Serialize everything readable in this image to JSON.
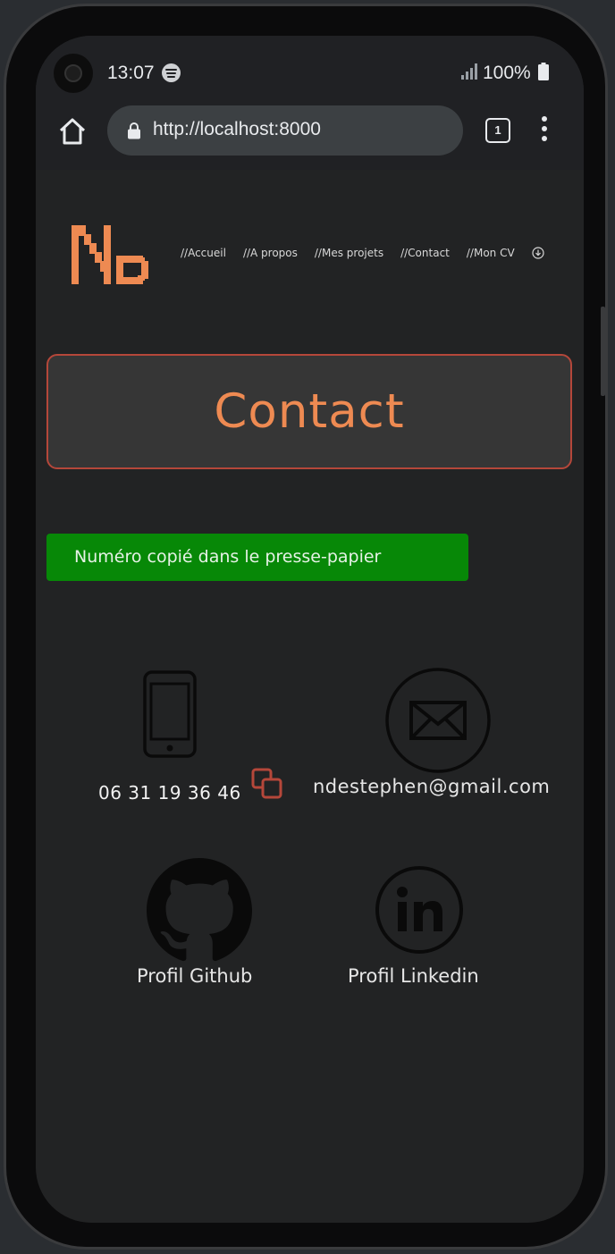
{
  "statusbar": {
    "time": "13:07",
    "battery": "100%",
    "icons": [
      "spotify-icon",
      "signal-icon",
      "battery-icon"
    ]
  },
  "browser": {
    "url": "http://localhost:8000",
    "tab_count": "1",
    "icons": [
      "home-icon",
      "lock-icon",
      "tabs-icon",
      "menu-dots-icon"
    ]
  },
  "site": {
    "logo_text": "ND",
    "nav": [
      "//Accueil",
      "//A propos",
      "//Mes projets",
      "//Contact",
      "//Mon CV"
    ],
    "accent_color": "#ee8a52",
    "border_color": "#b5473a"
  },
  "main": {
    "title": "Contact",
    "toast": "Numéro copié dans le presse-papier",
    "toast_color": "#078807",
    "phone": "06 31 19 36 46",
    "email": "ndestephen@gmail.com",
    "github_label": "Profil Github",
    "linkedin_label": "Profil Linkedin"
  }
}
